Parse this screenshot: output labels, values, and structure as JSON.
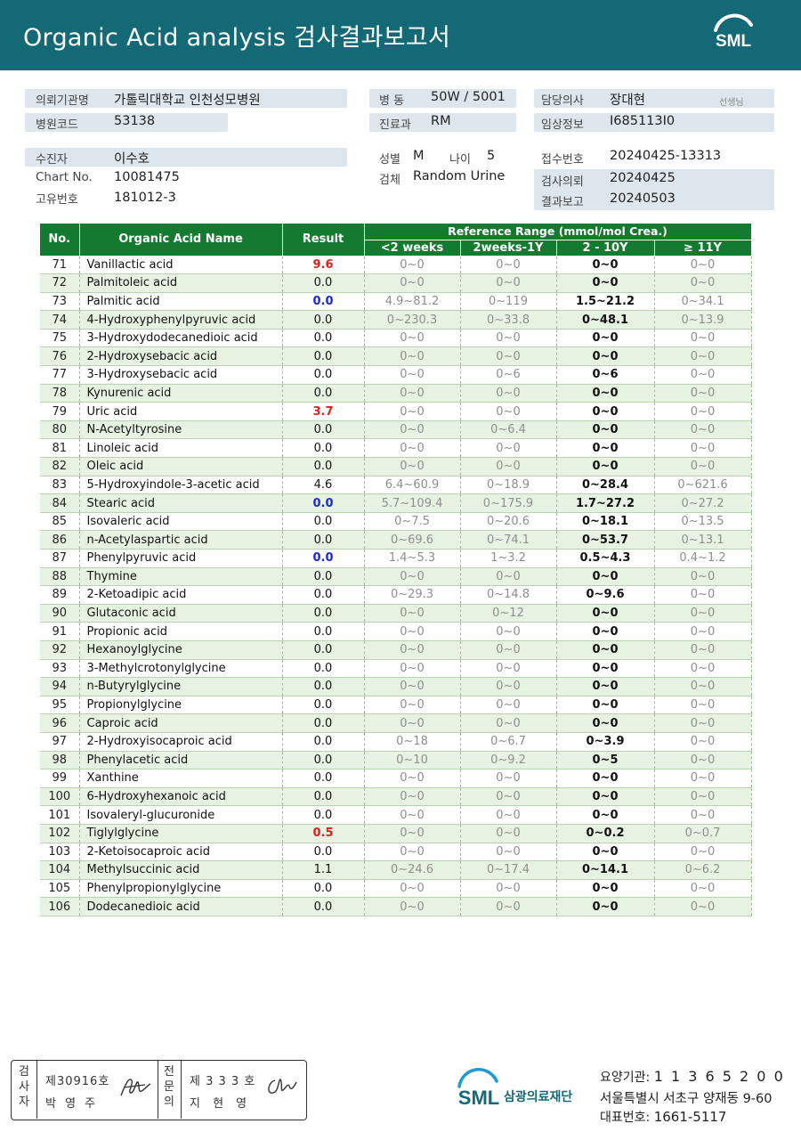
{
  "header": {
    "title": "Organic Acid analysis 검사결과보고서",
    "logo_text": "SML"
  },
  "info": {
    "institution_label": "의뢰기관명",
    "institution_value": "가톨릭대학교 인천성모병원",
    "hospital_code_label": "병원코드",
    "hospital_code_value": "53138",
    "ward_label": "병 동",
    "ward_value": "50W / 5001",
    "dept_label": "진료과",
    "dept_value": "RM",
    "doctor_label": "담당의사",
    "doctor_value": "장대현",
    "doctor_suffix": "선생님",
    "clinical_label": "임상정보",
    "clinical_value": "I685113I0",
    "patient_label": "수진자",
    "patient_value": "이수호",
    "chart_label": "Chart No.",
    "chart_value": "10081475",
    "uid_label": "고유번호",
    "uid_value": "181012-3",
    "sex_label": "성별",
    "sex_value": "M",
    "age_label": "나이",
    "age_value": "5",
    "specimen_label": "검체",
    "specimen_value": "Random Urine",
    "receipt_label": "접수번호",
    "receipt_value": "20240425-13313",
    "request_label": "검사의뢰",
    "request_value": "20240425",
    "report_label": "결과보고",
    "report_value": "20240503"
  },
  "table": {
    "headers": {
      "no": "No.",
      "name": "Organic Acid Name",
      "result": "Result",
      "reference": "Reference Range (mmol/mol Crea.)",
      "ranges": [
        "<2 weeks",
        "2weeks-1Y",
        "2 - 10Y",
        "≥ 11Y"
      ]
    },
    "rows": [
      {
        "no": "71",
        "name": "Vanillactic acid",
        "result": "9.6",
        "flag": "high",
        "r1": "0~0",
        "r2": "0~0",
        "r3": "0~0",
        "r4": "0~0"
      },
      {
        "no": "72",
        "name": "Palmitoleic acid",
        "result": "0.0",
        "flag": "",
        "r1": "0~0",
        "r2": "0~0",
        "r3": "0~0",
        "r4": "0~0"
      },
      {
        "no": "73",
        "name": "Palmitic acid",
        "result": "0.0",
        "flag": "low",
        "r1": "4.9~81.2",
        "r2": "0~119",
        "r3": "1.5~21.2",
        "r4": "0~34.1"
      },
      {
        "no": "74",
        "name": "4-Hydroxyphenylpyruvic acid",
        "result": "0.0",
        "flag": "",
        "r1": "0~230.3",
        "r2": "0~33.8",
        "r3": "0~48.1",
        "r4": "0~13.9"
      },
      {
        "no": "75",
        "name": "3-Hydroxydodecanedioic acid",
        "result": "0.0",
        "flag": "",
        "r1": "0~0",
        "r2": "0~0",
        "r3": "0~0",
        "r4": "0~0"
      },
      {
        "no": "76",
        "name": "2-Hydroxysebacic acid",
        "result": "0.0",
        "flag": "",
        "r1": "0~0",
        "r2": "0~0",
        "r3": "0~0",
        "r4": "0~0"
      },
      {
        "no": "77",
        "name": "3-Hydroxysebacic acid",
        "result": "0.0",
        "flag": "",
        "r1": "0~0",
        "r2": "0~6",
        "r3": "0~6",
        "r4": "0~0"
      },
      {
        "no": "78",
        "name": "Kynurenic acid",
        "result": "0.0",
        "flag": "",
        "r1": "0~0",
        "r2": "0~0",
        "r3": "0~0",
        "r4": "0~0"
      },
      {
        "no": "79",
        "name": "Uric acid",
        "result": "3.7",
        "flag": "high",
        "r1": "0~0",
        "r2": "0~0",
        "r3": "0~0",
        "r4": "0~0"
      },
      {
        "no": "80",
        "name": "N-Acetyltyrosine",
        "result": "0.0",
        "flag": "",
        "r1": "0~0",
        "r2": "0~6.4",
        "r3": "0~0",
        "r4": "0~0"
      },
      {
        "no": "81",
        "name": "Linoleic acid",
        "result": "0.0",
        "flag": "",
        "r1": "0~0",
        "r2": "0~0",
        "r3": "0~0",
        "r4": "0~0"
      },
      {
        "no": "82",
        "name": "Oleic acid",
        "result": "0.0",
        "flag": "",
        "r1": "0~0",
        "r2": "0~0",
        "r3": "0~0",
        "r4": "0~0"
      },
      {
        "no": "83",
        "name": "5-Hydroxyindole-3-acetic acid",
        "result": "4.6",
        "flag": "",
        "r1": "6.4~60.9",
        "r2": "0~18.9",
        "r3": "0~28.4",
        "r4": "0~621.6"
      },
      {
        "no": "84",
        "name": "Stearic acid",
        "result": "0.0",
        "flag": "low",
        "r1": "5.7~109.4",
        "r2": "0~175.9",
        "r3": "1.7~27.2",
        "r4": "0~27.2"
      },
      {
        "no": "85",
        "name": "Isovaleric acid",
        "result": "0.0",
        "flag": "",
        "r1": "0~7.5",
        "r2": "0~20.6",
        "r3": "0~18.1",
        "r4": "0~13.5"
      },
      {
        "no": "86",
        "name": "n-Acetylaspartic acid",
        "result": "0.0",
        "flag": "",
        "r1": "0~69.6",
        "r2": "0~74.1",
        "r3": "0~53.7",
        "r4": "0~13.1"
      },
      {
        "no": "87",
        "name": "Phenylpyruvic acid",
        "result": "0.0",
        "flag": "low",
        "r1": "1.4~5.3",
        "r2": "1~3.2",
        "r3": "0.5~4.3",
        "r4": "0.4~1.2"
      },
      {
        "no": "88",
        "name": "Thymine",
        "result": "0.0",
        "flag": "",
        "r1": "0~0",
        "r2": "0~0",
        "r3": "0~0",
        "r4": "0~0"
      },
      {
        "no": "89",
        "name": "2-Ketoadipic acid",
        "result": "0.0",
        "flag": "",
        "r1": "0~29.3",
        "r2": "0~14.8",
        "r3": "0~9.6",
        "r4": "0~0"
      },
      {
        "no": "90",
        "name": "Glutaconic acid",
        "result": "0.0",
        "flag": "",
        "r1": "0~0",
        "r2": "0~12",
        "r3": "0~0",
        "r4": "0~0"
      },
      {
        "no": "91",
        "name": "Propionic acid",
        "result": "0.0",
        "flag": "",
        "r1": "0~0",
        "r2": "0~0",
        "r3": "0~0",
        "r4": "0~0"
      },
      {
        "no": "92",
        "name": "Hexanoylglycine",
        "result": "0.0",
        "flag": "",
        "r1": "0~0",
        "r2": "0~0",
        "r3": "0~0",
        "r4": "0~0"
      },
      {
        "no": "93",
        "name": "3-Methylcrotonylglycine",
        "result": "0.0",
        "flag": "",
        "r1": "0~0",
        "r2": "0~0",
        "r3": "0~0",
        "r4": "0~0"
      },
      {
        "no": "94",
        "name": "n-Butyrylglycine",
        "result": "0.0",
        "flag": "",
        "r1": "0~0",
        "r2": "0~0",
        "r3": "0~0",
        "r4": "0~0"
      },
      {
        "no": "95",
        "name": "Propionylglycine",
        "result": "0.0",
        "flag": "",
        "r1": "0~0",
        "r2": "0~0",
        "r3": "0~0",
        "r4": "0~0"
      },
      {
        "no": "96",
        "name": "Caproic acid",
        "result": "0.0",
        "flag": "",
        "r1": "0~0",
        "r2": "0~0",
        "r3": "0~0",
        "r4": "0~0"
      },
      {
        "no": "97",
        "name": "2-Hydroxyisocaproic acid",
        "result": "0.0",
        "flag": "",
        "r1": "0~18",
        "r2": "0~6.7",
        "r3": "0~3.9",
        "r4": "0~0"
      },
      {
        "no": "98",
        "name": "Phenylacetic acid",
        "result": "0.0",
        "flag": "",
        "r1": "0~10",
        "r2": "0~9.2",
        "r3": "0~5",
        "r4": "0~0"
      },
      {
        "no": "99",
        "name": "Xanthine",
        "result": "0.0",
        "flag": "",
        "r1": "0~0",
        "r2": "0~0",
        "r3": "0~0",
        "r4": "0~0"
      },
      {
        "no": "100",
        "name": "6-Hydroxyhexanoic acid",
        "result": "0.0",
        "flag": "",
        "r1": "0~0",
        "r2": "0~0",
        "r3": "0~0",
        "r4": "0~0"
      },
      {
        "no": "101",
        "name": "Isovaleryl-glucuronide",
        "result": "0.0",
        "flag": "",
        "r1": "0~0",
        "r2": "0~0",
        "r3": "0~0",
        "r4": "0~0"
      },
      {
        "no": "102",
        "name": "Tiglylglycine",
        "result": "0.5",
        "flag": "high",
        "r1": "0~0",
        "r2": "0~0",
        "r3": "0~0.2",
        "r4": "0~0.7"
      },
      {
        "no": "103",
        "name": "2-Ketoisocaproic acid",
        "result": "0.0",
        "flag": "",
        "r1": "0~0",
        "r2": "0~0",
        "r3": "0~0",
        "r4": "0~0"
      },
      {
        "no": "104",
        "name": "Methylsuccinic acid",
        "result": "1.1",
        "flag": "",
        "r1": "0~24.6",
        "r2": "0~17.4",
        "r3": "0~14.1",
        "r4": "0~6.2"
      },
      {
        "no": "105",
        "name": "Phenylpropionylglycine",
        "result": "0.0",
        "flag": "",
        "r1": "0~0",
        "r2": "0~0",
        "r3": "0~0",
        "r4": "0~0"
      },
      {
        "no": "106",
        "name": "Dodecanedioic acid",
        "result": "0.0",
        "flag": "",
        "r1": "0~0",
        "r2": "0~0",
        "r3": "0~0",
        "r4": "0~0"
      }
    ]
  },
  "signature": {
    "tester_label": "검사자",
    "tester_license": "제30916호",
    "tester_name": "박 영 주",
    "specialist_label": "전문의",
    "specialist_license": "제 3 3 3 호",
    "specialist_name": "지 현 영"
  },
  "footer": {
    "logo_text": "SML",
    "org_name": "삼광의료재단",
    "code_label": "요양기관:",
    "code_value": "1 1 3 6 5 2 0 0",
    "address": "서울특별시 서초구 양재동 9-60",
    "phone_label": "대표번호:",
    "phone_value": "1661-5117"
  },
  "colors": {
    "header": "#136a76",
    "table_header": "#137a2f",
    "high": "#e0201c",
    "low": "#1c27e0"
  }
}
